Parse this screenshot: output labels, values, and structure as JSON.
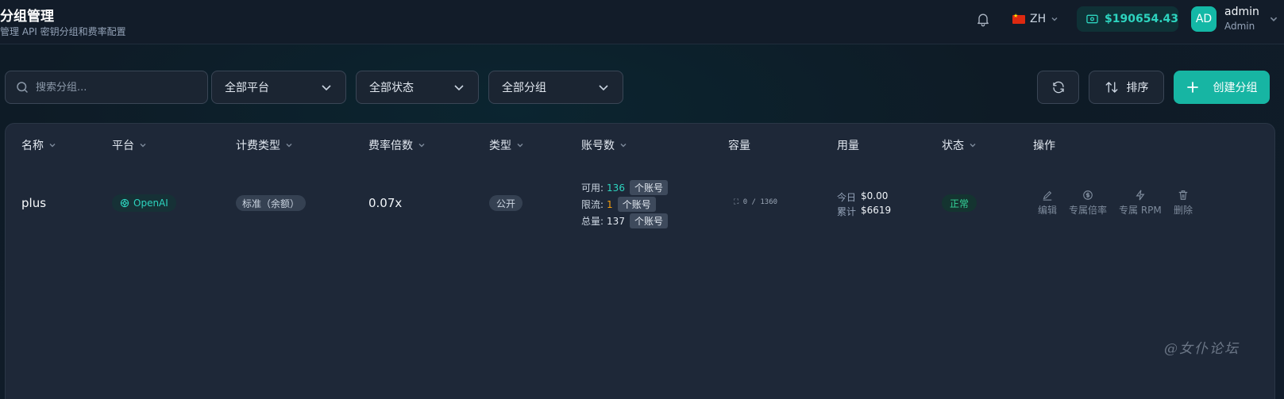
{
  "header": {
    "title": "分组管理",
    "subtitle": "管理 API 密钥分组和费率配置",
    "language": "ZH",
    "balance": "$190654.43",
    "user": {
      "initials": "AD",
      "name": "admin",
      "role": "Admin"
    }
  },
  "toolbar": {
    "search_placeholder": "搜索分组...",
    "platform_filter": "全部平台",
    "status_filter": "全部状态",
    "group_filter": "全部分组",
    "sort_label": "排序",
    "create_label": "创建分组"
  },
  "table": {
    "columns": [
      "名称",
      "平台",
      "计费类型",
      "费率倍数",
      "类型",
      "账号数",
      "容量",
      "用量",
      "状态",
      "操作"
    ],
    "rows": [
      {
        "name": "plus",
        "platform": "OpenAI",
        "billing_type": "标准（余额）",
        "rate": "0.07x",
        "type": "公开",
        "accounts": {
          "available_label": "可用:",
          "available": "136",
          "limited_label": "限流:",
          "limited": "1",
          "total_label": "总量:",
          "total": "137",
          "unit": "个账号"
        },
        "capacity": "⛶ 0 / 1360",
        "usage": {
          "today_label": "今日",
          "today": "$0.00",
          "total_label": "累计",
          "total": "$6619"
        },
        "status": "正常",
        "actions": [
          "编辑",
          "专属倍率",
          "专属 RPM",
          "删除"
        ]
      }
    ]
  },
  "watermark": "@女仆论坛",
  "colors": {
    "accent": "#17b5a3",
    "status_ok": "#34d399",
    "limited": "#f59e0b",
    "available": "#2dd4bf"
  }
}
